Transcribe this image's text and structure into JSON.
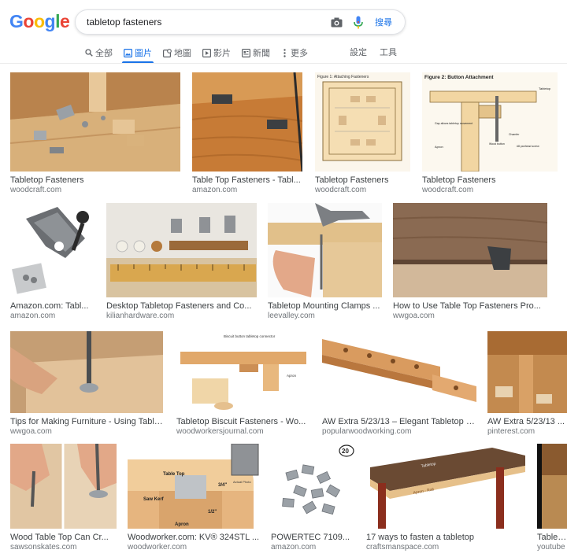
{
  "logo": [
    "G",
    "o",
    "o",
    "g",
    "l",
    "e"
  ],
  "search": {
    "query": "tabletop fasteners",
    "button_label": "搜尋"
  },
  "tabs": [
    {
      "label": "全部",
      "icon": "search-icon"
    },
    {
      "label": "圖片",
      "icon": "image-icon"
    },
    {
      "label": "地圖",
      "icon": "map-icon"
    },
    {
      "label": "影片",
      "icon": "video-icon"
    },
    {
      "label": "新聞",
      "icon": "news-icon"
    },
    {
      "label": "更多",
      "icon": "more-icon"
    }
  ],
  "tools": {
    "settings": "設定",
    "tools": "工具"
  },
  "results": [
    {
      "caption": "Tabletop Fasteners",
      "source": "woodcraft.com"
    },
    {
      "caption": "Table Top Fasteners - Tabl...",
      "source": "amazon.com"
    },
    {
      "caption": "Tabletop Fasteners",
      "source": "woodcraft.com"
    },
    {
      "caption": "Tabletop Fasteners",
      "source": "woodcraft.com"
    },
    {
      "caption": "Amazon.com: Tabl...",
      "source": "amazon.com"
    },
    {
      "caption": "Desktop Tabletop Fasteners and Co...",
      "source": "kilianhardware.com"
    },
    {
      "caption": "Tabletop Mounting Clamps ...",
      "source": "leevalley.com"
    },
    {
      "caption": "How to Use Table Top Fasteners Pro...",
      "source": "wwgoa.com"
    },
    {
      "caption": "Tips for Making Furniture - Using Table...",
      "source": "wwgoa.com"
    },
    {
      "caption": "Tabletop Biscuit Fasteners - Wo...",
      "source": "woodworkersjournal.com"
    },
    {
      "caption": "AW Extra 5/23/13 – Elegant Tabletop Fas",
      "source": "popularwoodworking.com"
    },
    {
      "caption": "AW Extra 5/23/13 ...",
      "source": "pinterest.com"
    },
    {
      "caption": "Wood Table Top Can Cr...",
      "source": "sawsonskates.com"
    },
    {
      "caption": "Woodworker.com: KV® 324STL ...",
      "source": "woodworker.com"
    },
    {
      "caption": "POWERTEC 7109...",
      "source": "amazon.com"
    },
    {
      "caption": "17 ways to fasten a tabletop",
      "source": "craftsmanspace.com"
    },
    {
      "caption": "Table To",
      "source": "youtube"
    }
  ],
  "image_text": {
    "fig1_title": "Figure 1: Attaching Fasteners",
    "fig2_title": "Figure 2: Button Attachment",
    "fig2_tabletop": "Tabletop",
    "fig2_apron": "Apron",
    "fig2_gap": "Gap allows tabletop movement",
    "fig2_chamfer": "Chamfer",
    "fig2_wood_button": "Wood button",
    "fig2_screw": "#8 panhead screw",
    "biscuit_label": "Biscuit button tabletop connector",
    "biscuit_apron": "Apron",
    "kv_tabletop": "Table Top",
    "kv_saw_kerf": "Saw Kerf",
    "kv_apron": "Apron",
    "kv_34": "3/4\"",
    "kv_12": "1/2\"",
    "kv_actual": "Actual Photo",
    "powertec_badge": "20",
    "ways_tabletop": "Tabletop",
    "ways_apron_rail": "Apron - Rail"
  }
}
